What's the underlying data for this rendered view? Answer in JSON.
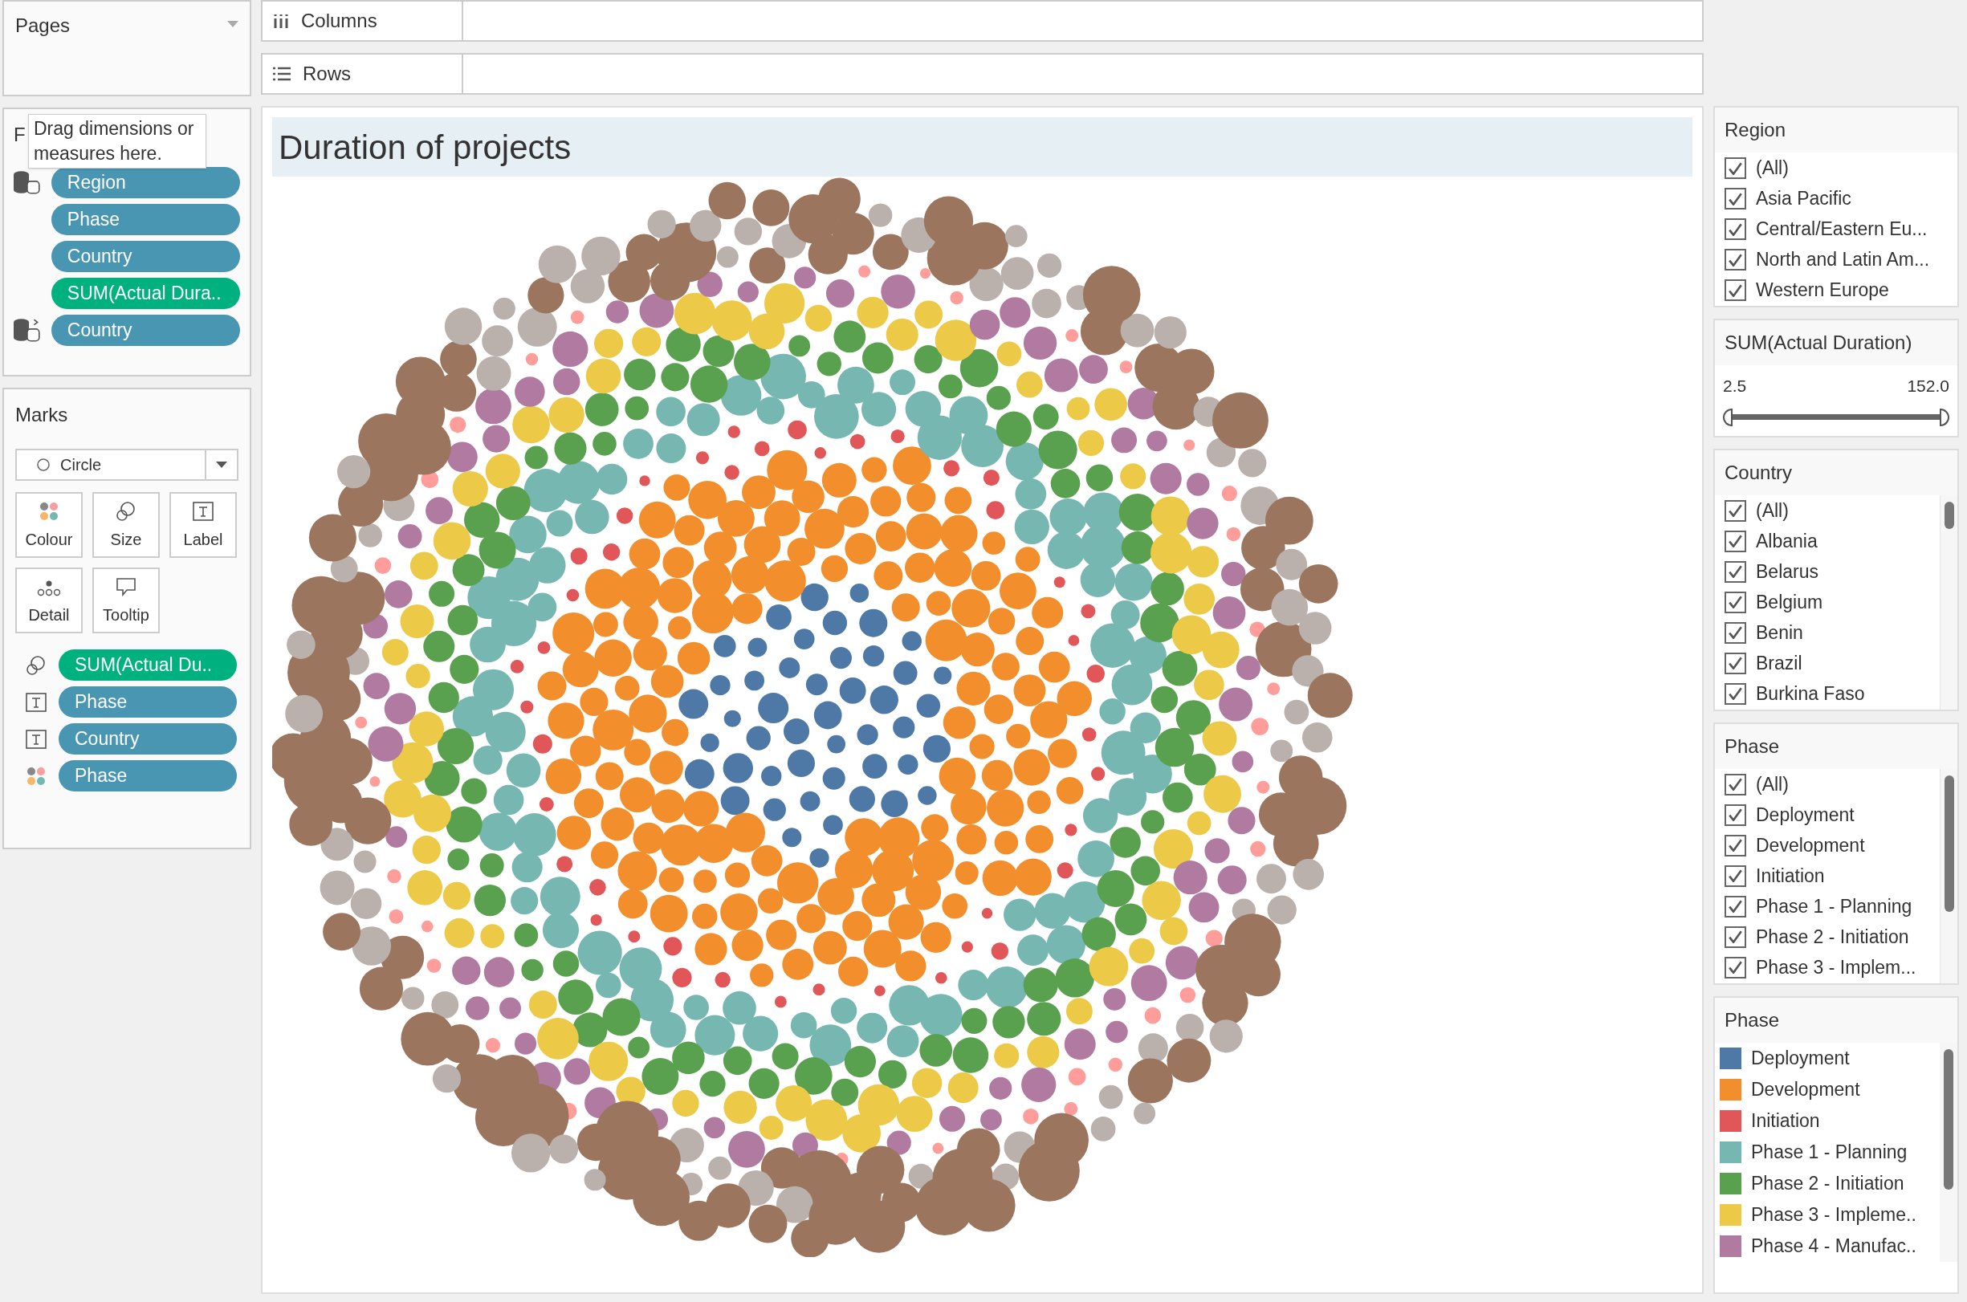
{
  "pages": {
    "title": "Pages"
  },
  "shelves": [
    {
      "kind": "columns",
      "label": "Columns"
    },
    {
      "kind": "rows",
      "label": "Rows"
    }
  ],
  "filters": {
    "title": "F",
    "tooltip": "Drag dimensions or measures here.",
    "pills": [
      {
        "label": "Region",
        "color": "#4996b2"
      },
      {
        "label": "Phase",
        "color": "#4996b2"
      },
      {
        "label": "Country",
        "color": "#4996b2"
      },
      {
        "label": "SUM(Actual Dura..",
        "color": "#00b180"
      },
      {
        "label": "Country",
        "color": "#4996b2"
      }
    ]
  },
  "marks": {
    "title": "Marks",
    "mark_type": "Circle",
    "cards": [
      {
        "kind": "color",
        "label": "Colour"
      },
      {
        "kind": "size",
        "label": "Size"
      },
      {
        "kind": "label",
        "label": "Label"
      },
      {
        "kind": "detail",
        "label": "Detail"
      },
      {
        "kind": "tooltip",
        "label": "Tooltip"
      }
    ],
    "pills": [
      {
        "kind": "size",
        "label": "SUM(Actual Du..",
        "color": "#00b180"
      },
      {
        "kind": "label",
        "label": "Phase",
        "color": "#4996b2"
      },
      {
        "kind": "label",
        "label": "Country",
        "color": "#4996b2"
      },
      {
        "kind": "color",
        "label": "Phase",
        "color": "#4996b2"
      }
    ]
  },
  "view": {
    "title": "Duration of projects"
  },
  "region_filter": {
    "title": "Region",
    "items": [
      {
        "label": "(All)",
        "checked": true
      },
      {
        "label": "Asia Pacific",
        "checked": true
      },
      {
        "label": "Central/Eastern Eu...",
        "checked": true
      },
      {
        "label": "North and Latin Am...",
        "checked": true
      },
      {
        "label": "Western Europe",
        "checked": true
      }
    ]
  },
  "duration_filter": {
    "title": "SUM(Actual Duration)",
    "min": "2.5",
    "max": "152.0",
    "level": 1
  },
  "country_filter": {
    "title": "Country",
    "items": [
      {
        "label": "(All)",
        "checked": true
      },
      {
        "label": "Albania",
        "checked": true
      },
      {
        "label": "Belarus",
        "checked": true
      },
      {
        "label": "Belgium",
        "checked": true
      },
      {
        "label": "Benin",
        "checked": true
      },
      {
        "label": "Brazil",
        "checked": true
      },
      {
        "label": "Burkina Faso",
        "checked": true
      }
    ]
  },
  "phase_filter": {
    "title": "Phase",
    "items": [
      {
        "label": "(All)",
        "checked": true
      },
      {
        "label": "Deployment",
        "checked": true
      },
      {
        "label": "Development",
        "checked": true
      },
      {
        "label": "Initiation",
        "checked": true
      },
      {
        "label": "Phase 1 - Planning",
        "checked": true
      },
      {
        "label": "Phase 2 - Initiation",
        "checked": true
      },
      {
        "label": "Phase 3 - Implem...",
        "checked": true
      }
    ]
  },
  "phase_legend": {
    "title": "Phase",
    "items": [
      {
        "label": "Deployment",
        "color": "#4e79a7"
      },
      {
        "label": "Development",
        "color": "#f28e2b"
      },
      {
        "label": "Initiation",
        "color": "#e15759"
      },
      {
        "label": "Phase 1 - Planning",
        "color": "#76b7b2"
      },
      {
        "label": "Phase 2 - Initiation",
        "color": "#59a14f"
      },
      {
        "label": "Phase 3 - Impleme..",
        "color": "#edc948"
      },
      {
        "label": "Phase 4 - Manufac..",
        "color": "#b07aa1"
      }
    ]
  }
}
